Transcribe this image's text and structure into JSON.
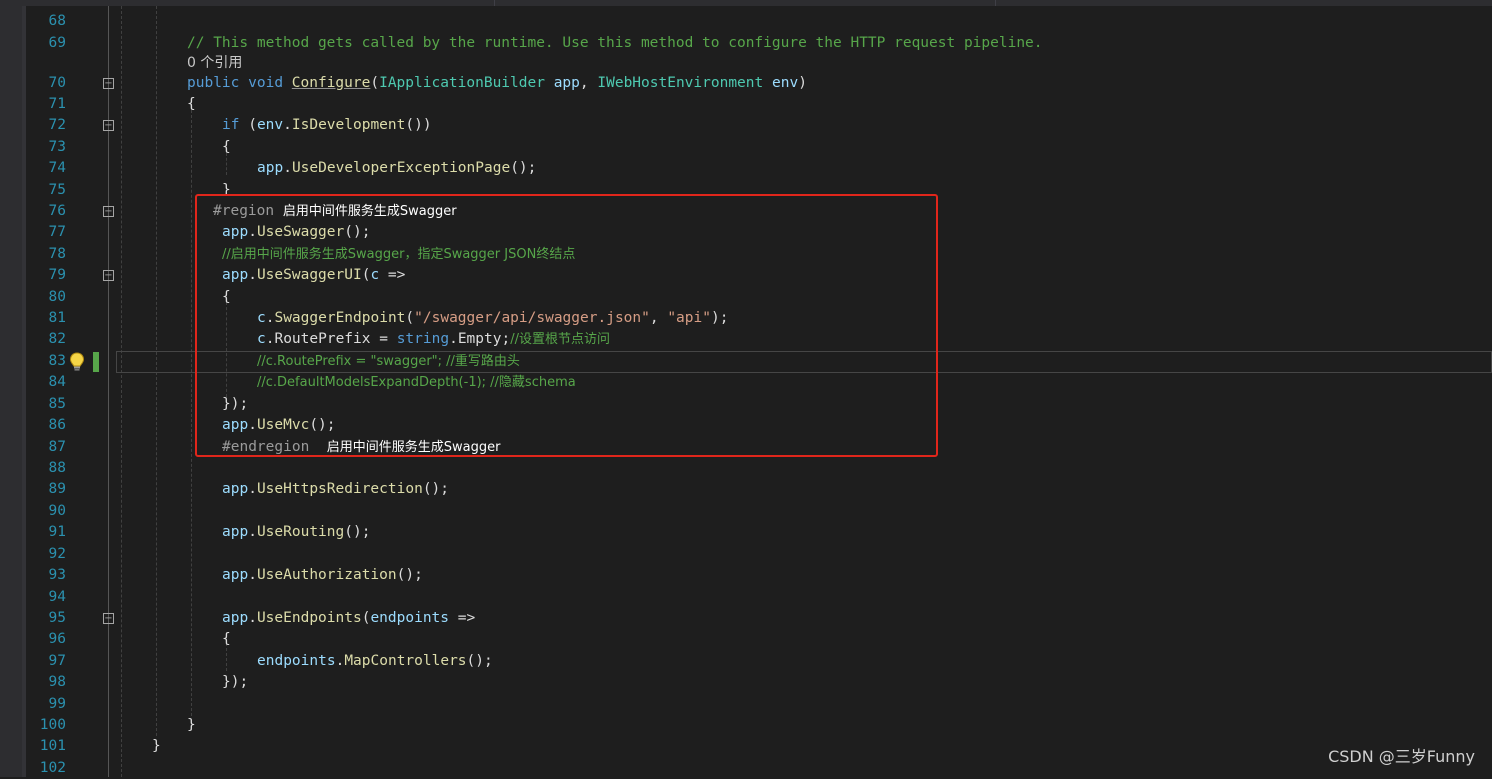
{
  "watermark": "CSDN @三岁Funny",
  "code": {
    "l68": "",
    "l69_comment": "// This method gets called by the runtime. Use this method to configure the HTTP request pipeline.",
    "references": "0 个引用",
    "l70": {
      "public": "public",
      "void": "void",
      "method": "Configure",
      "open": "(",
      "type1": "IApplicationBuilder",
      "param1": "app",
      "comma": ", ",
      "type2": "IWebHostEnvironment",
      "param2": "env",
      "close": ")"
    },
    "l71": "{",
    "l72": {
      "if": "if",
      "open": " (",
      "env": "env",
      "dot": ".",
      "prop": "IsDevelopment",
      "close": "())"
    },
    "l73": "{",
    "l74": {
      "app": "app",
      "dot": ".",
      "method": "UseDeveloperExceptionPage",
      "rest": "();"
    },
    "l75": "}",
    "l76": {
      "region": "#region",
      "text": "启用中间件服务生成Swagger"
    },
    "l77": {
      "app": "app",
      "dot": ".",
      "method": "UseSwagger",
      "rest": "();"
    },
    "l78_comment": "//启用中间件服务生成Swagger，指定Swagger JSON终结点",
    "l79": {
      "app": "app",
      "dot": ".",
      "method": "UseSwaggerUI",
      "open": "(",
      "param": "c",
      "arrow": " =>"
    },
    "l80": "{",
    "l81": {
      "c": "c",
      "dot": ".",
      "method": "SwaggerEndpoint",
      "open": "(",
      "str1": "\"/swagger/api/swagger.json\"",
      "comma": ", ",
      "str2": "\"api\"",
      "close": ");"
    },
    "l82": {
      "c": "c",
      "dot": ".",
      "prop": "RoutePrefix",
      "eq": " = ",
      "kw": "string",
      "dot2": ".",
      "member": "Empty",
      "semi": ";",
      "comment": "//设置根节点访问"
    },
    "l83_comment": "//c.RoutePrefix = \"swagger\"; //重写路由头",
    "l84_comment": "//c.DefaultModelsExpandDepth(-1); //隐藏schema",
    "l85": "});",
    "l86": {
      "app": "app",
      "dot": ".",
      "method": "UseMvc",
      "rest": "();"
    },
    "l87": {
      "endregion": "#endregion",
      "text": "启用中间件服务生成Swagger"
    },
    "l89": {
      "app": "app",
      "dot": ".",
      "method": "UseHttpsRedirection",
      "rest": "();"
    },
    "l91": {
      "app": "app",
      "dot": ".",
      "method": "UseRouting",
      "rest": "();"
    },
    "l93": {
      "app": "app",
      "dot": ".",
      "method": "UseAuthorization",
      "rest": "();"
    },
    "l95": {
      "app": "app",
      "dot": ".",
      "method": "UseEndpoints",
      "open": "(",
      "param": "endpoints",
      "arrow": " =>"
    },
    "l96": "{",
    "l97": {
      "obj": "endpoints",
      "dot": ".",
      "method": "MapControllers",
      "rest": "();"
    },
    "l98": "});",
    "l100": "}",
    "l101": "}"
  },
  "line_numbers": [
    "68",
    "69",
    "70",
    "71",
    "72",
    "73",
    "74",
    "75",
    "76",
    "77",
    "78",
    "79",
    "80",
    "81",
    "82",
    "83",
    "84",
    "85",
    "86",
    "87",
    "88",
    "89",
    "90",
    "91",
    "92",
    "93",
    "94",
    "95",
    "96",
    "97",
    "98",
    "99",
    "100",
    "101",
    "102"
  ],
  "icons": {
    "lightbulb": "lightbulb-icon",
    "fold": "collapse-icon"
  },
  "colors": {
    "background": "#1e1e1e",
    "line_number": "#2b91af",
    "keyword": "#569cd6",
    "comment": "#57a64a",
    "string": "#d69d85",
    "type": "#4ec9b0",
    "method": "#dcdcaa",
    "parameter": "#9cdcfe",
    "annotation_box": "#e0261b"
  }
}
